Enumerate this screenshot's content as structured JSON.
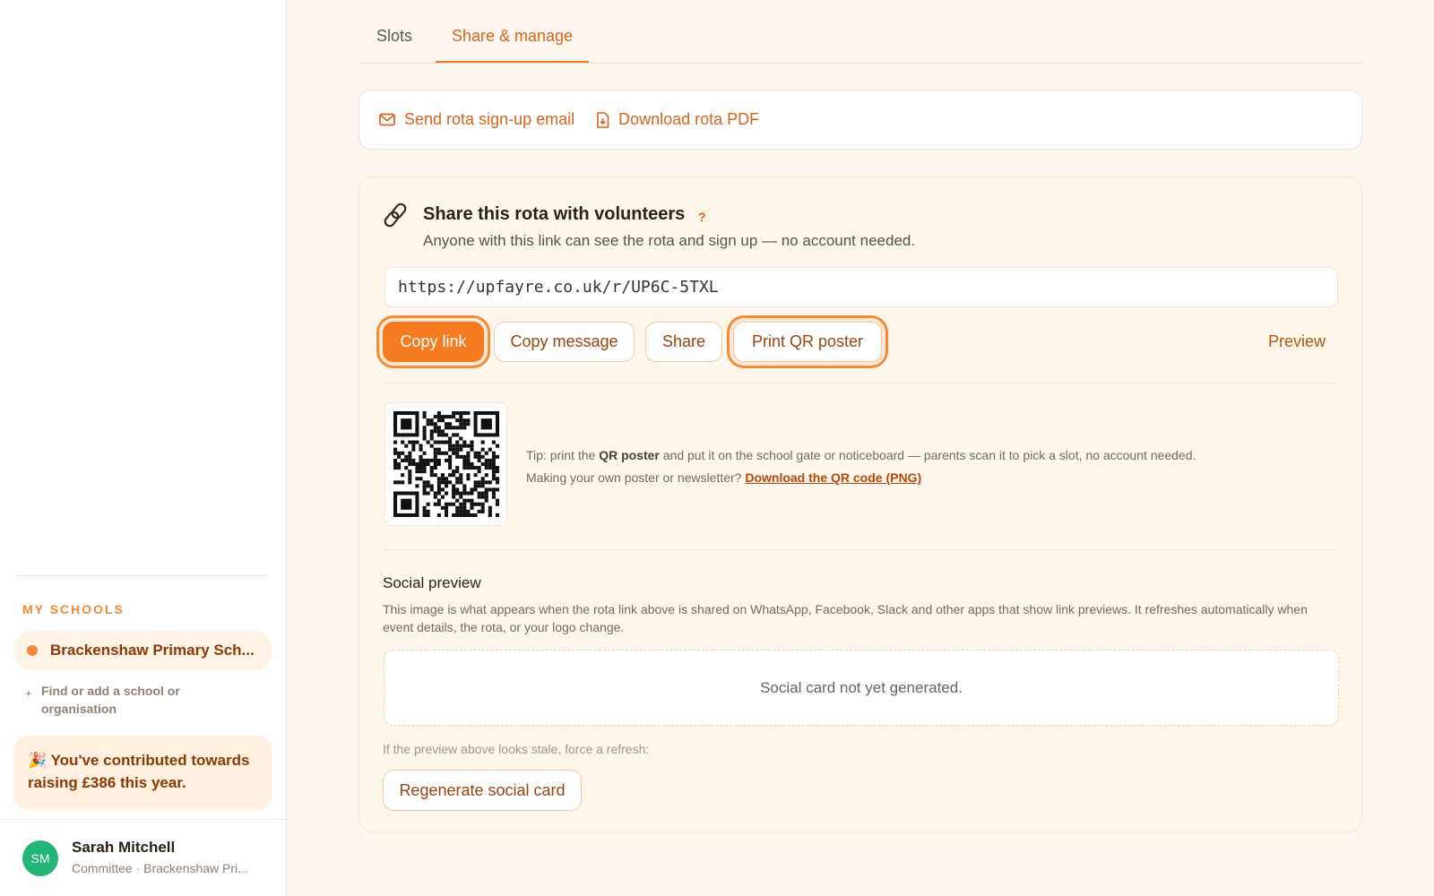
{
  "colors": {
    "accent": "#f47b1f",
    "accent_text": "#d7641c",
    "avatar_bg": "#22b573"
  },
  "tabs": [
    {
      "label": "Slots",
      "active": false
    },
    {
      "label": "Share & manage",
      "active": true
    }
  ],
  "actions": {
    "send_email": {
      "label": "Send rota sign-up email",
      "icon": "mail-icon"
    },
    "download_pdf": {
      "label": "Download rota PDF",
      "icon": "file-download-icon"
    }
  },
  "share": {
    "icon": "link-icon",
    "title": "Share this rota with volunteers",
    "help": "?",
    "subtitle": "Anyone with this link can see the rota and sign up — no account needed.",
    "url": "https://upfayre.co.uk/r/UP6C-5TXL",
    "buttons": {
      "copy_link": "Copy link",
      "copy_message": "Copy message",
      "share": "Share",
      "print_qr": "Print QR poster",
      "preview": "Preview"
    },
    "tip": {
      "prefix": "Tip: print the",
      "bold": "QR poster",
      "suffix": "and put it on the school gate or noticeboard — parents scan it to pick a slot, no account needed.",
      "line2": "Making your own poster or newsletter?",
      "link": "Download the QR code (PNG)"
    }
  },
  "social": {
    "title": "Social preview",
    "description": "This image is what appears when the rota link above is shared on WhatsApp, Facebook, Slack and other apps that show link previews. It refreshes automatically when event details, the rota, or your logo change.",
    "placeholder": "Social card not yet generated.",
    "stale_note": "If the preview above looks stale, force a refresh:",
    "regen_button": "Regenerate social card"
  },
  "sidebar": {
    "schools_heading": "MY SCHOOLS",
    "school": "Brackenshaw Primary Sch...",
    "find_plus": "+",
    "find_label": "Find or add a school or organisation",
    "contrib_emoji": "🎉",
    "contrib_text": "You've contributed towards raising £386 this year.",
    "profile": {
      "initials": "SM",
      "name": "Sarah Mitchell",
      "role": "Committee · Brackenshaw Pri..."
    }
  }
}
